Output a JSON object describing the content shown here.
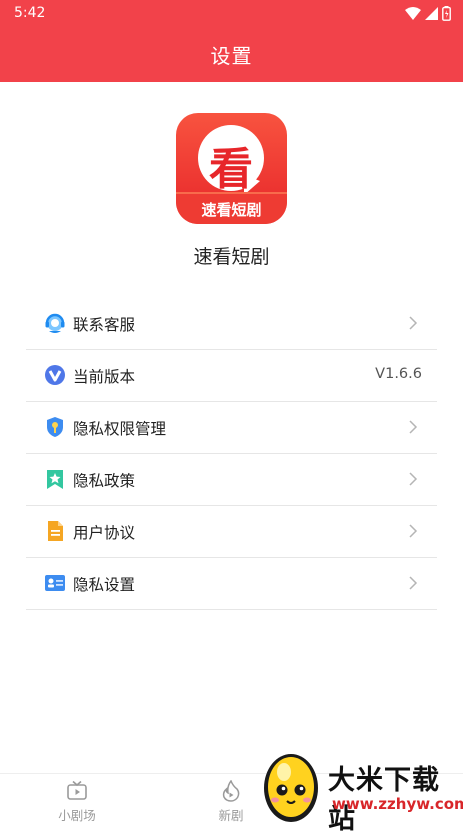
{
  "status_bar": {
    "time": "5:42"
  },
  "header": {
    "title": "设置"
  },
  "app": {
    "logo_char": "看",
    "logo_caption": "速看短剧",
    "name": "速看短剧"
  },
  "menu": [
    {
      "label": "联系客服",
      "icon": "customer-service-headset-icon"
    },
    {
      "label": "当前版本",
      "icon": "version-v-icon",
      "value": "V1.6.6"
    },
    {
      "label": "隐私权限管理",
      "icon": "shield-key-icon"
    },
    {
      "label": "隐私政策",
      "icon": "bookmark-star-icon"
    },
    {
      "label": "用户协议",
      "icon": "document-icon"
    },
    {
      "label": "隐私设置",
      "icon": "id-card-icon"
    }
  ],
  "bottom_nav": [
    {
      "label": "小剧场",
      "icon": "tv-play-icon"
    },
    {
      "label": "新剧",
      "icon": "flame-play-icon"
    }
  ],
  "watermark": {
    "title": "大米下载站",
    "url": "www.zzhyw.com"
  },
  "colors": {
    "brand": "#f2424a",
    "watermark_url": "#d8262a"
  }
}
